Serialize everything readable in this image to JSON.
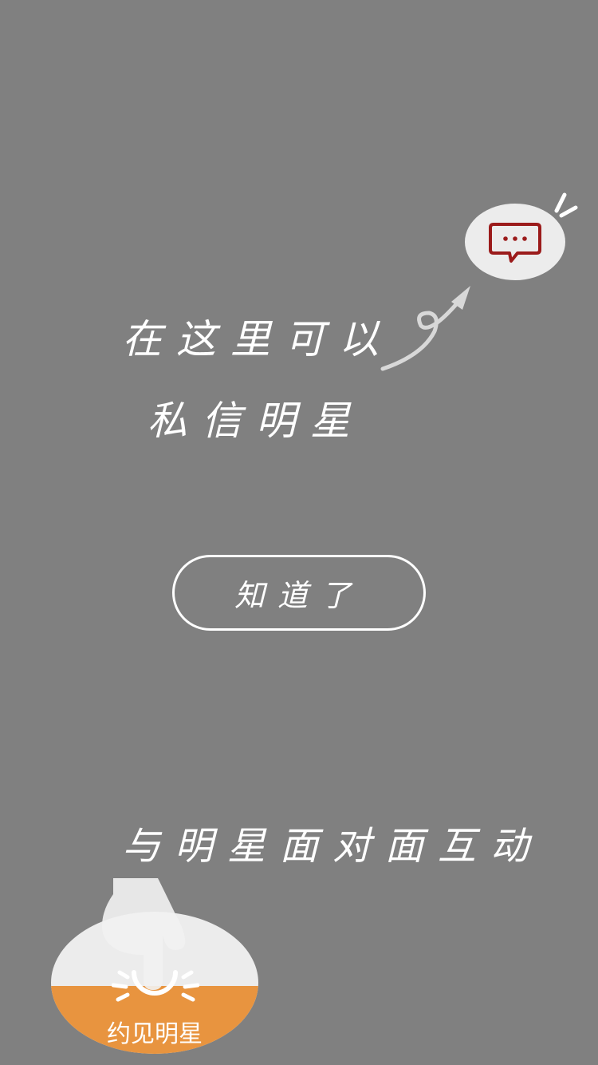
{
  "guide": {
    "line1": "在这里可以",
    "line2": "私信明星",
    "button_label": "知道了",
    "line3": "与明星面对面互动"
  },
  "tab": {
    "meet_label": "约见明星"
  },
  "colors": {
    "overlay": "#808080",
    "bubble": "#ececec",
    "message_icon": "#9b1b1b",
    "accent": "#e8943f",
    "text": "#ffffff"
  },
  "icons": {
    "message": "chat-bubble-icon",
    "arrow": "curved-arrow-icon",
    "sparkle": "sparkle-lines-icon",
    "sun": "sun-icon",
    "hand": "pointing-hand-icon"
  }
}
